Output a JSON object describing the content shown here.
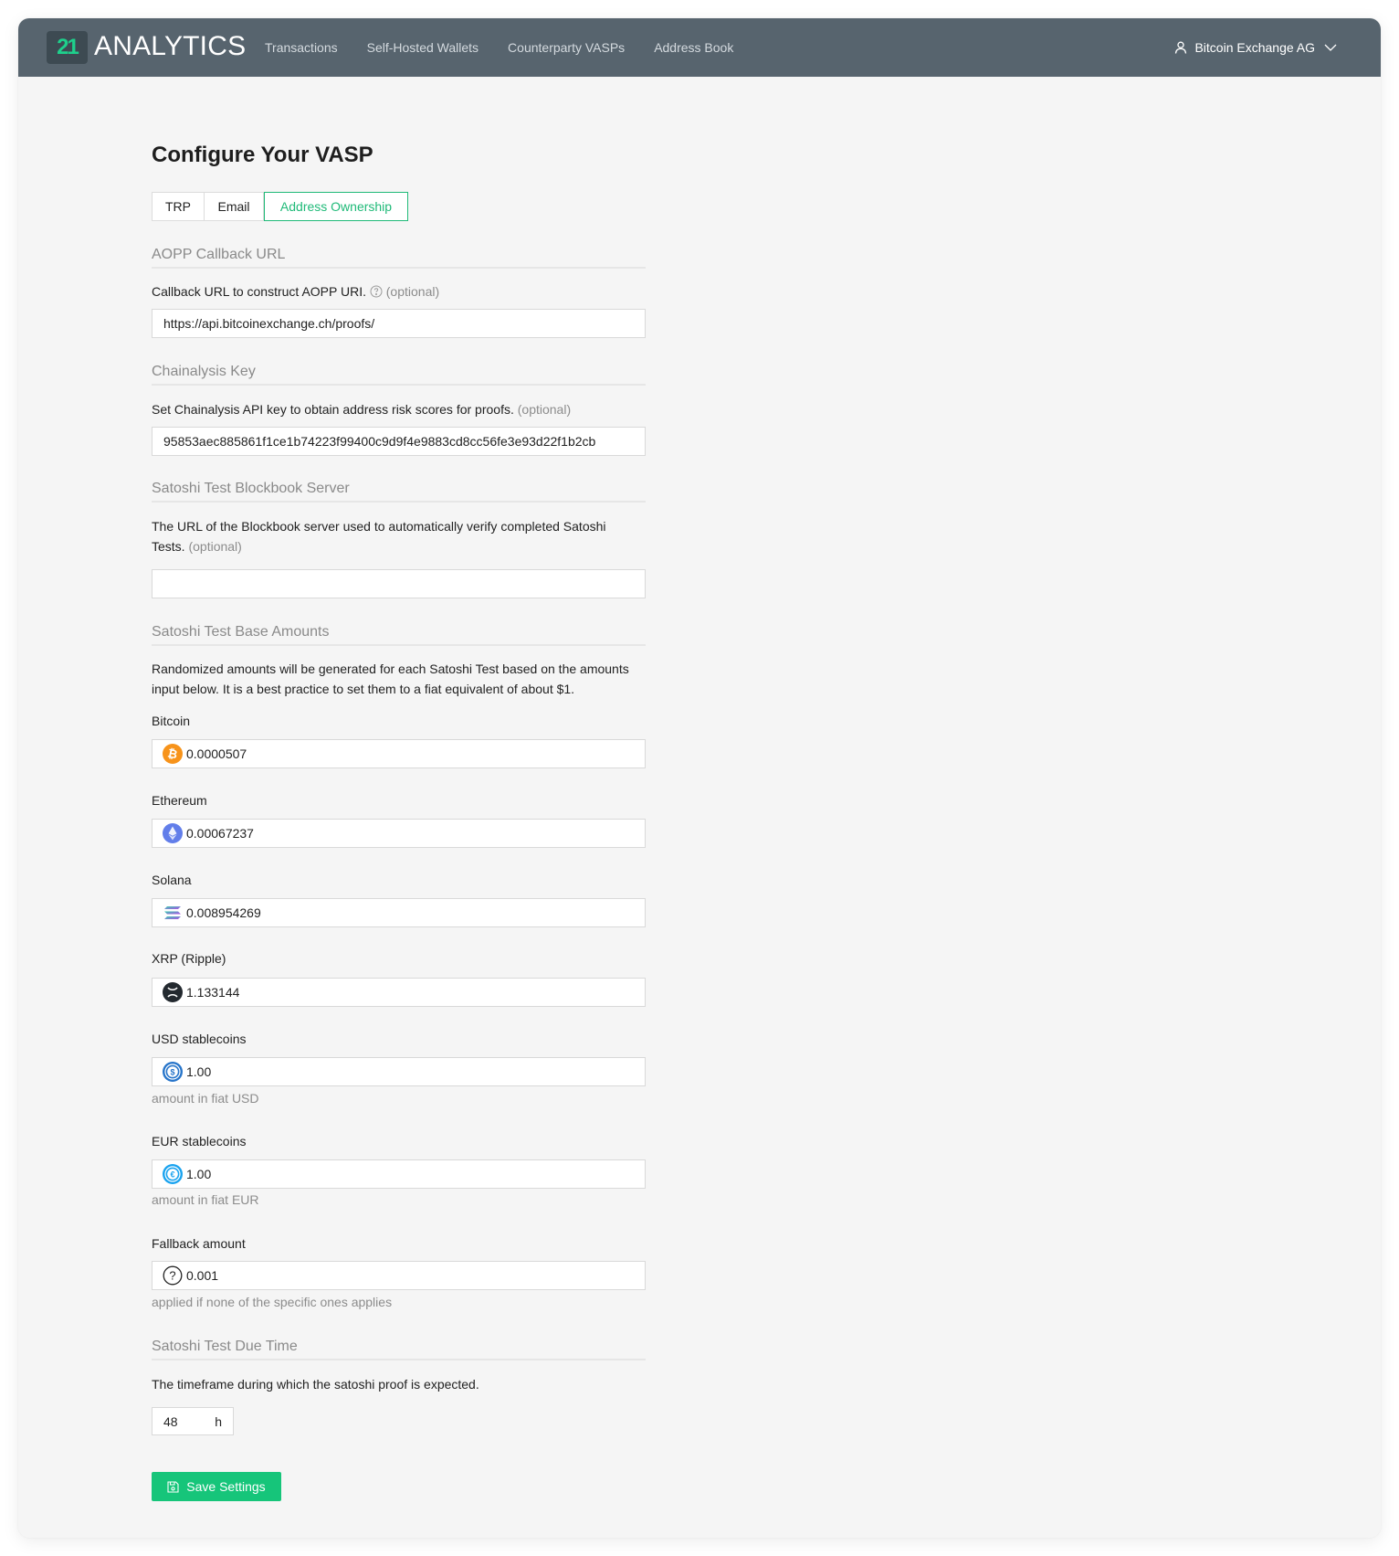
{
  "header": {
    "logo_mark": "21",
    "logo_text": "ANALYTICS",
    "nav": [
      {
        "label": "Transactions"
      },
      {
        "label": "Self-Hosted Wallets"
      },
      {
        "label": "Counterparty VASPs"
      },
      {
        "label": "Address Book"
      }
    ],
    "user": {
      "name": "Bitcoin Exchange AG",
      "icon": "user-icon",
      "dropdown_icon": "chevron-down-icon"
    }
  },
  "page": {
    "title": "Configure Your VASP",
    "tabs": [
      {
        "label": "TRP",
        "active": false
      },
      {
        "label": "Email",
        "active": false
      },
      {
        "label": "Address Ownership",
        "active": true
      }
    ]
  },
  "sections": {
    "aopp": {
      "title": "AOPP Callback URL",
      "description": "Callback URL to construct AOPP URI.",
      "optional": "(optional)",
      "value": "https://api.bitcoinexchange.ch/proofs/"
    },
    "chainalysis": {
      "title": "Chainalysis Key",
      "description": "Set Chainalysis API key to obtain address risk scores for proofs.",
      "optional": "(optional)",
      "value": "95853aec885861f1ce1b74223f99400c9d9f4e9883cd8cc56fe3e93d22f1b2cb"
    },
    "blockbook": {
      "title": "Satoshi Test Blockbook Server",
      "description_line1": "The URL of the Blockbook server used to automatically verify completed Satoshi",
      "description_line2": "Tests.",
      "optional": "(optional)",
      "value": ""
    },
    "base_amounts": {
      "title": "Satoshi Test Base Amounts",
      "description_line1": "Randomized amounts will be generated for each Satoshi Test based on the amounts",
      "description_line2": "input below. It is a best practice to set them to a fiat equivalent of about $1.",
      "fields": [
        {
          "label": "Bitcoin",
          "icon": "bitcoin-icon",
          "value": "0.0000507",
          "helper": ""
        },
        {
          "label": "Ethereum",
          "icon": "ethereum-icon",
          "value": "0.00067237",
          "helper": ""
        },
        {
          "label": "Solana",
          "icon": "solana-icon",
          "value": "0.008954269",
          "helper": ""
        },
        {
          "label": "XRP (Ripple)",
          "icon": "xrp-icon",
          "value": "1.133144",
          "helper": ""
        },
        {
          "label": "USD stablecoins",
          "icon": "usdc-icon",
          "value": "1.00",
          "helper": "amount in fiat USD"
        },
        {
          "label": "EUR stablecoins",
          "icon": "eurc-icon",
          "value": "1.00",
          "helper": "amount in fiat EUR"
        },
        {
          "label": "Fallback amount",
          "icon": "question-circle-icon",
          "value": "0.001",
          "helper": "applied if none of the specific ones applies"
        }
      ]
    },
    "due_time": {
      "title": "Satoshi Test Due Time",
      "description": "The timeframe during which the satoshi proof is expected.",
      "value": "48",
      "unit": "h"
    }
  },
  "actions": {
    "save_label": "Save Settings",
    "save_icon": "save-icon"
  },
  "colors": {
    "header_bg": "#57646e",
    "accent": "#16c57a",
    "logo_green": "#1ed08c",
    "page_bg": "#f5f5f5"
  }
}
